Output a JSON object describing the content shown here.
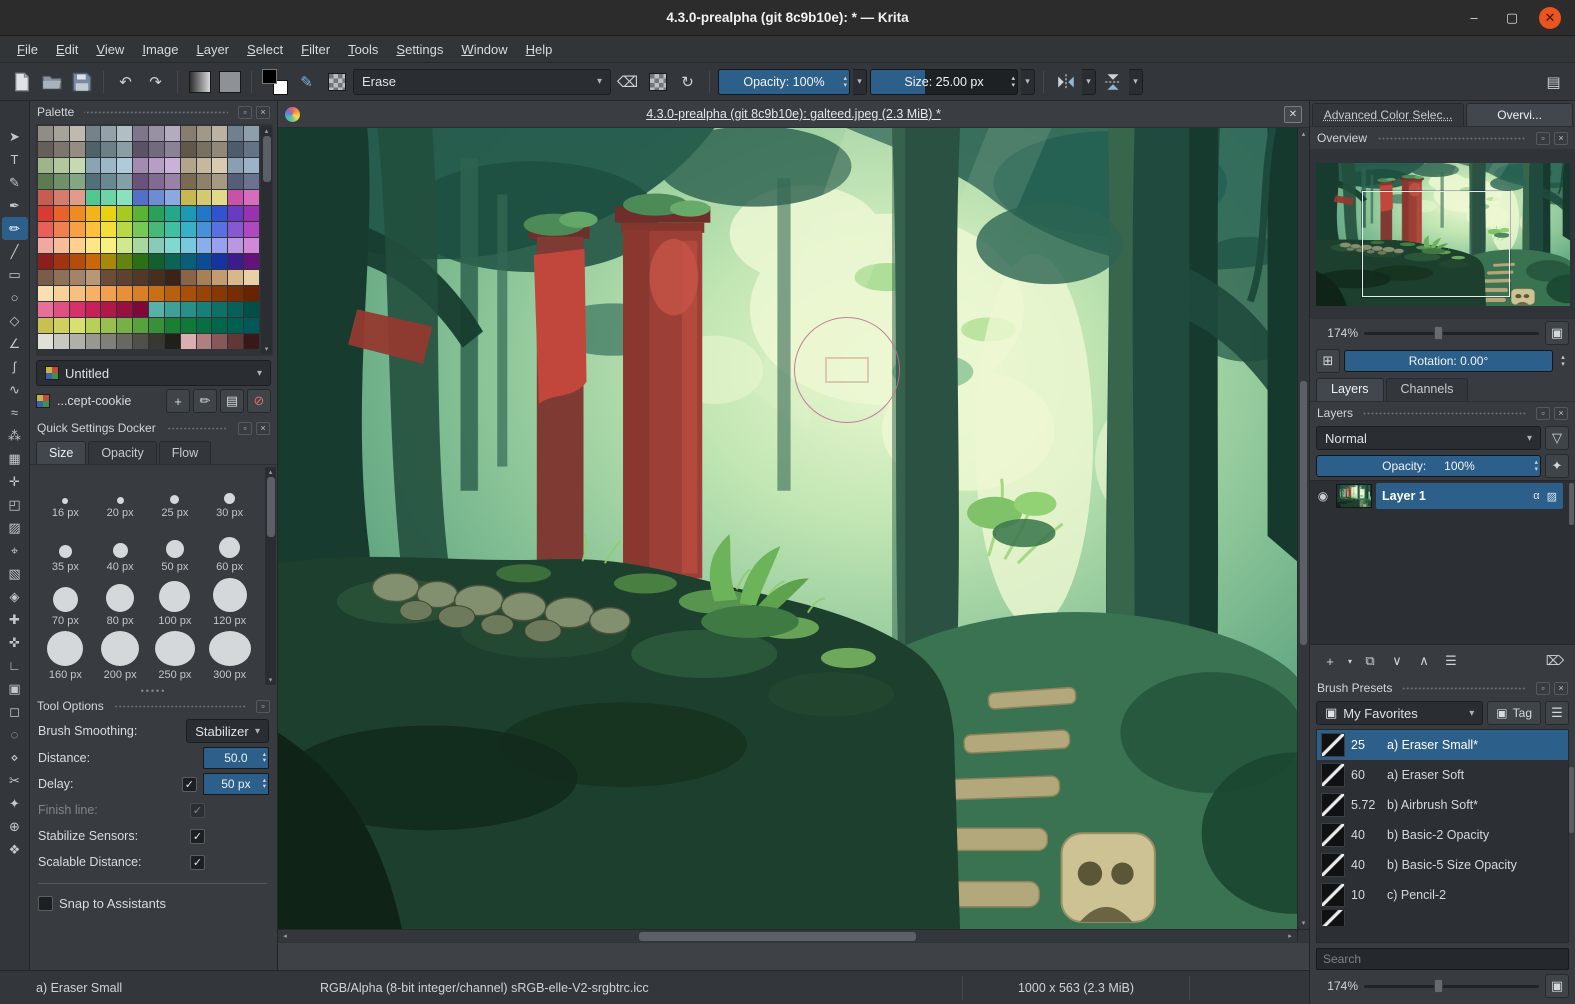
{
  "window": {
    "title": "4.3.0-prealpha (git 8c9b10e): * — Krita"
  },
  "icons": {
    "minimize": "–",
    "maximize": "▢",
    "close": "✕",
    "close_small": "×",
    "float": "▫",
    "undo": "↶",
    "redo": "↷",
    "reload": "↻",
    "eraser": "⌫",
    "caret": "▾",
    "spin_up": "▴",
    "spin_down": "▾",
    "left": "◂",
    "right": "▸",
    "plus": "+",
    "edit": "✏",
    "folder": "▤",
    "block": "⊘",
    "check": "✓",
    "eye": "◉",
    "alpha": "α",
    "alpha_lock": "▨",
    "layer_add": "+",
    "layer_duplicate": "⧉",
    "layer_down": "∨",
    "layer_up": "∧",
    "layer_props": "☰",
    "layer_delete": "⌦",
    "funnel": "▽",
    "fx": "✦",
    "fit": "▣",
    "grid": "⊞",
    "tag": "▣",
    "listview": "☰",
    "workspace": "▤",
    "brush_editor": "✎"
  },
  "menu": {
    "items": [
      "File",
      "Edit",
      "View",
      "Image",
      "Layer",
      "Select",
      "Filter",
      "Tools",
      "Settings",
      "Window",
      "Help"
    ]
  },
  "toolbar": {
    "preset_combo": "Erase",
    "opacity_label": "Opacity: 100%",
    "size_label": "Size: 25.00 px"
  },
  "metrics": {
    "opacity_fill_pct": 100,
    "size_fill_pct": 37,
    "rotation_fill_pct": 100,
    "layer_opacity_fill_pct": 100,
    "overview_zoom_pos_pct": 40,
    "bottom_zoom_pos_pct": 40
  },
  "toolbox": {
    "tools": [
      {
        "name": "select-shapes",
        "glyph": "➤",
        "active": false
      },
      {
        "name": "text",
        "glyph": "T",
        "active": false
      },
      {
        "name": "edit-shapes",
        "glyph": "✎",
        "active": false
      },
      {
        "name": "calligraphy",
        "glyph": "✒",
        "active": false
      },
      {
        "name": "freehand-brush",
        "glyph": "✏",
        "active": true
      },
      {
        "name": "line",
        "glyph": "╱",
        "active": false
      },
      {
        "name": "rectangle",
        "glyph": "▭",
        "active": false
      },
      {
        "name": "ellipse",
        "glyph": "○",
        "active": false
      },
      {
        "name": "polygon",
        "glyph": "◇",
        "active": false
      },
      {
        "name": "polyline",
        "glyph": "∠",
        "active": false
      },
      {
        "name": "bezier-curve",
        "glyph": "ʃ",
        "active": false
      },
      {
        "name": "freehand-path",
        "glyph": "∿",
        "active": false
      },
      {
        "name": "dynamic-brush",
        "glyph": "≈",
        "active": false
      },
      {
        "name": "multibrush",
        "glyph": "⁂",
        "active": false
      },
      {
        "name": "transform",
        "glyph": "▦",
        "active": false
      },
      {
        "name": "move",
        "glyph": "✛",
        "active": false
      },
      {
        "name": "crop",
        "glyph": "◰",
        "active": false
      },
      {
        "name": "gradient",
        "glyph": "▨",
        "active": false
      },
      {
        "name": "color-sampler",
        "glyph": "⌖",
        "active": false
      },
      {
        "name": "pattern-edit",
        "glyph": "▧",
        "active": false
      },
      {
        "name": "fill",
        "glyph": "◈",
        "active": false
      },
      {
        "name": "smart-patch",
        "glyph": "✚",
        "active": false
      },
      {
        "name": "assistants",
        "glyph": "✜",
        "active": false
      },
      {
        "name": "measure",
        "glyph": "∟",
        "active": false
      },
      {
        "name": "reference-images",
        "glyph": "▣",
        "active": false
      },
      {
        "name": "select-rectangular",
        "glyph": "◻",
        "active": false
      },
      {
        "name": "select-elliptical",
        "glyph": "◌",
        "active": false
      },
      {
        "name": "select-polygonal",
        "glyph": "⋄",
        "active": false
      },
      {
        "name": "select-freehand",
        "glyph": "✂",
        "active": false
      },
      {
        "name": "select-similar",
        "glyph": "✦",
        "active": false
      },
      {
        "name": "zoom",
        "glyph": "⊕",
        "active": false
      },
      {
        "name": "pan",
        "glyph": "❖",
        "active": false
      }
    ]
  },
  "palette": {
    "title": "Palette",
    "combo_label": "Untitled",
    "name": "...cept-cookie",
    "swatch_rows": [
      [
        "#918d85",
        "#a8a39a",
        "#bfb9ae",
        "#74828a",
        "#92a2a8",
        "#b0bfc2",
        "#80768c",
        "#9a90a6",
        "#b4abc0",
        "#887e70",
        "#a2988a",
        "#bcb2a4",
        "#70808f",
        "#8e9eab"
      ],
      [
        "#655f57",
        "#7d766c",
        "#958d82",
        "#4f626a",
        "#6d8088",
        "#8b9ea6",
        "#5c5268",
        "#746a80",
        "#8c8298",
        "#62584a",
        "#7a7062",
        "#92887a",
        "#4c5c6c",
        "#647484"
      ],
      [
        "#9fb48b",
        "#b2c79e",
        "#c5dab1",
        "#8ba4b4",
        "#9eb7c7",
        "#b1cada",
        "#a48bb4",
        "#b79ec7",
        "#cab1da",
        "#b4a48b",
        "#c7b79e",
        "#dacab1",
        "#8b9fb4",
        "#9eb2c7"
      ],
      [
        "#5e7a52",
        "#71906a",
        "#84a682",
        "#52707a",
        "#6a8890",
        "#82a0a6",
        "#6a527a",
        "#826a90",
        "#9a82a6",
        "#7a6a52",
        "#90826a",
        "#a69a82",
        "#525e7a",
        "#6a7490"
      ],
      [
        "#c75d52",
        "#d47c6e",
        "#e19b8a",
        "#52c792",
        "#6ed4a8",
        "#8ae1be",
        "#5270c7",
        "#6e8cd4",
        "#8aa8e1",
        "#c7b852",
        "#d4c96e",
        "#e1da8a",
        "#c752a8",
        "#d46ebc"
      ],
      [
        "#d93a32",
        "#e8622a",
        "#f08a22",
        "#f4b31a",
        "#e6d312",
        "#a8c822",
        "#5ab432",
        "#2aa05a",
        "#22a88a",
        "#1a9ab4",
        "#2278c8",
        "#3252d0",
        "#6a3ac0",
        "#9a32b0"
      ],
      [
        "#e86058",
        "#f08050",
        "#f8a048",
        "#ffc040",
        "#f0e038",
        "#b8d848",
        "#78c858",
        "#48b878",
        "#40c0a0",
        "#38b0c8",
        "#4890d8",
        "#5870e0",
        "#8858d0",
        "#b048c0"
      ],
      [
        "#f0a8a0",
        "#f8bc98",
        "#ffd090",
        "#ffe488",
        "#f8f080",
        "#d0e890",
        "#a8d8a0",
        "#88ccb8",
        "#80d8d0",
        "#78c8e0",
        "#88b0e8",
        "#98a0f0",
        "#b898e0",
        "#d088d8"
      ],
      [
        "#8c1f1a",
        "#a03410",
        "#b44c0c",
        "#c86808",
        "#a8880c",
        "#648410",
        "#2c7014",
        "#14602c",
        "#0c6454",
        "#086078",
        "#0c4c94",
        "#1434a0",
        "#3c1c8c",
        "#641478"
      ],
      [
        "#7a5c48",
        "#8e7058",
        "#a28468",
        "#b69878",
        "#6a4c38",
        "#5e4230",
        "#523828",
        "#462e20",
        "#3a2418",
        "#8a6448",
        "#a88058",
        "#c29c70",
        "#d8b888",
        "#e8d0a8"
      ],
      [
        "#f8e0b0",
        "#f8d098",
        "#f8c080",
        "#f8b068",
        "#f0a050",
        "#e89038",
        "#d88028",
        "#c87018",
        "#b86010",
        "#a85008",
        "#984404",
        "#883802",
        "#782c00",
        "#682400"
      ],
      [
        "#e87098",
        "#e05080",
        "#d83068",
        "#c82058",
        "#b01848",
        "#981040",
        "#800838",
        "#58b0a8",
        "#40a098",
        "#289088",
        "#188078",
        "#107068",
        "#086058",
        "#005048"
      ],
      [
        "#c8c050",
        "#d0d060",
        "#d8e070",
        "#b8d058",
        "#98c050",
        "#78b048",
        "#58a040",
        "#389038",
        "#188030",
        "#107838",
        "#087040",
        "#006848",
        "#006050",
        "#005858"
      ],
      [
        "#e0e0d8",
        "#c8c8c0",
        "#b0b0a8",
        "#989890",
        "#808078",
        "#686860",
        "#505048",
        "#383830",
        "#202018",
        "#d8b0b0",
        "#b08080",
        "#885858",
        "#603838",
        "#381818"
      ]
    ]
  },
  "quick": {
    "title": "Quick Settings Docker",
    "tabs": [
      "Size",
      "Opacity",
      "Flow"
    ],
    "active_tab": "Size",
    "sizes": [
      {
        "label": "16 px",
        "d": 6
      },
      {
        "label": "20 px",
        "d": 7
      },
      {
        "label": "25 px",
        "d": 9
      },
      {
        "label": "30 px",
        "d": 11
      },
      {
        "label": "35 px",
        "d": 13
      },
      {
        "label": "40 px",
        "d": 15
      },
      {
        "label": "50 px",
        "d": 18
      },
      {
        "label": "60 px",
        "d": 21
      },
      {
        "label": "70 px",
        "d": 25
      },
      {
        "label": "80 px",
        "d": 28
      },
      {
        "label": "100 px",
        "d": 31
      },
      {
        "label": "120 px",
        "d": 34
      },
      {
        "label": "160 px",
        "d": 36
      },
      {
        "label": "200 px",
        "d": 38
      },
      {
        "label": "250 px",
        "d": 40
      },
      {
        "label": "300 px",
        "d": 42
      }
    ]
  },
  "tool_options": {
    "title": "Tool Options",
    "smoothing_label": "Brush Smoothing:",
    "smoothing_value": "Stabilizer",
    "distance_label": "Distance:",
    "distance_value": "50.0",
    "delay_label": "Delay:",
    "delay_value": "50 px",
    "finish_label": "Finish line:",
    "stabilize_label": "Stabilize Sensors:",
    "scalable_label": "Scalable Distance:",
    "snap_label": "Snap to Assistants"
  },
  "canvas": {
    "title": "4.3.0-prealpha (git 8c9b10e): galteed.jpeg (2.3 MiB) *"
  },
  "right_panel": {
    "tabs": [
      {
        "label": "Advanced Color Selec...",
        "active": false,
        "focus": true
      },
      {
        "label": "Overvi...",
        "active": true,
        "focus": false
      }
    ]
  },
  "overview": {
    "title": "Overview",
    "zoom": "174%",
    "rotation": "Rotation: 0.00°"
  },
  "layers": {
    "tab_layers": "Layers",
    "tab_channels": "Channels",
    "title": "Layers",
    "blend_mode": "Normal",
    "opacity_label": "Opacity:",
    "opacity_value": "100%",
    "layer_name": "Layer 1"
  },
  "brush": {
    "title": "Brush Presets",
    "combo": "My Favorites",
    "tag_label": "Tag",
    "search_placeholder": "Search",
    "zoom": "174%",
    "items": [
      {
        "size": "25",
        "name": "a) Eraser Small*",
        "selected": true,
        "partial": false
      },
      {
        "size": "60",
        "name": "a) Eraser Soft",
        "selected": false,
        "partial": false
      },
      {
        "size": "5.72",
        "name": "b) Airbrush Soft*",
        "selected": false,
        "partial": false
      },
      {
        "size": "40",
        "name": "b) Basic-2 Opacity",
        "selected": false,
        "partial": false
      },
      {
        "size": "40",
        "name": "b) Basic-5 Size Opacity",
        "selected": false,
        "partial": false
      },
      {
        "size": "10",
        "name": "c) Pencil-2",
        "selected": false,
        "partial": false
      },
      {
        "size": "",
        "name": "",
        "selected": false,
        "partial": true
      }
    ]
  },
  "status": {
    "preset": "a) Eraser Small",
    "colorspace": "RGB/Alpha (8-bit integer/channel)  sRGB-elle-V2-srgbtrc.icc",
    "dims": "1000 x 563 (2.3 MiB)"
  }
}
